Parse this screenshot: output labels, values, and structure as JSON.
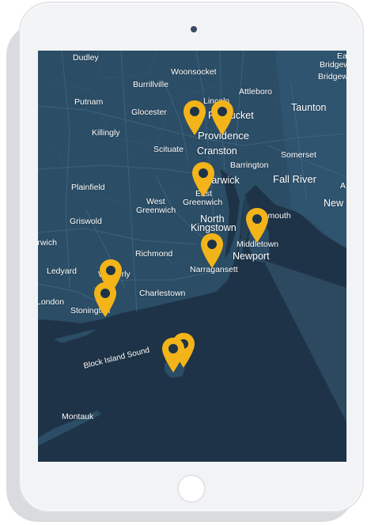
{
  "device": {
    "type": "tablet",
    "orientation": "portrait"
  },
  "map": {
    "style": "dark",
    "colors": {
      "land": "#2b4d66",
      "water": "#1e3347",
      "roads": "#3f6582",
      "labels": "#ffffff",
      "marker": "#f2b419"
    },
    "labels": {
      "dudley": "Dudley",
      "woonsocket": "Woonsocket",
      "burrillville": "Burrillville",
      "attleboro": "Attleboro",
      "putnam": "Putnam",
      "glocester": "Glocester",
      "lincoln": "Lincoln",
      "pawtucket": "Pawtucket",
      "taunton": "Taunton",
      "east": "East",
      "bridgew1": "Bridgew",
      "bridgew2": "Bridgew",
      "killingly": "Killingly",
      "providence": "Providence",
      "scituate": "Scituate",
      "cranston": "Cranston",
      "somerset": "Somerset",
      "barrington": "Barrington",
      "warwick": "Warwick",
      "plainfield": "Plainfield",
      "fall_river": "Fall River",
      "east_greenwich_1": "East",
      "east_greenwich_2": "Greenwich",
      "west_greenwich_1": "West",
      "west_greenwich_2": "Greenwich",
      "a_edge": "A",
      "new_edge": "New",
      "portsmouth": "Portsmouth",
      "north_kingstown_1": "North",
      "north_kingstown_2": "Kingstown",
      "griswold": "Griswold",
      "middletown": "Middletown",
      "norwich": "Norwich",
      "newport": "Newport",
      "richmond": "Richmond",
      "ledyard": "Ledyard",
      "narragansett": "Narragansett",
      "westerly": "Westerly",
      "charlestown": "Charlestown",
      "london": "London",
      "stonington": "Stonington",
      "block_island_sound": "Block Island Sound",
      "montauk": "Montauk"
    },
    "markers": [
      {
        "name": "Providence West"
      },
      {
        "name": "Pawtucket"
      },
      {
        "name": "East Greenwich"
      },
      {
        "name": "Portsmouth"
      },
      {
        "name": "Narragansett"
      },
      {
        "name": "Westerly"
      },
      {
        "name": "Stonington"
      },
      {
        "name": "Block Island"
      },
      {
        "name": "Block Island South"
      }
    ]
  }
}
